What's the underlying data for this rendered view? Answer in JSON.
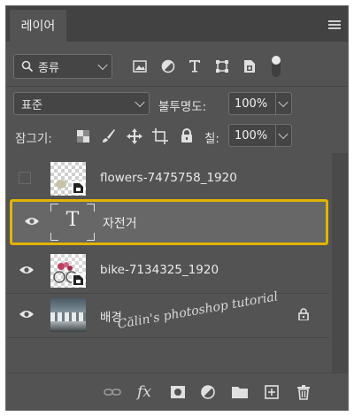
{
  "panel": {
    "tab_title": "레이어"
  },
  "filter": {
    "kind_label": "종류"
  },
  "blend": {
    "mode": "표준",
    "opacity_label": "불투명도:",
    "opacity_value": "100%"
  },
  "lock": {
    "label": "잠그기:",
    "fill_label": "칠:",
    "fill_value": "100%"
  },
  "layers": [
    {
      "name": "flowers-7475758_1920",
      "visible": false,
      "type": "smart-object"
    },
    {
      "name": "자전거",
      "visible": true,
      "type": "text",
      "selected": true
    },
    {
      "name": "bike-7134325_1920",
      "visible": true,
      "type": "smart-object"
    },
    {
      "name": "배경",
      "visible": true,
      "type": "background",
      "locked": true
    }
  ],
  "thumb_text_glyph": "T",
  "watermark": "Călin's photoshop tutorial",
  "bottom": {
    "fx_label": "fx"
  },
  "colors": {
    "selection_border": "#e2b404",
    "panel_bg": "#535353"
  }
}
